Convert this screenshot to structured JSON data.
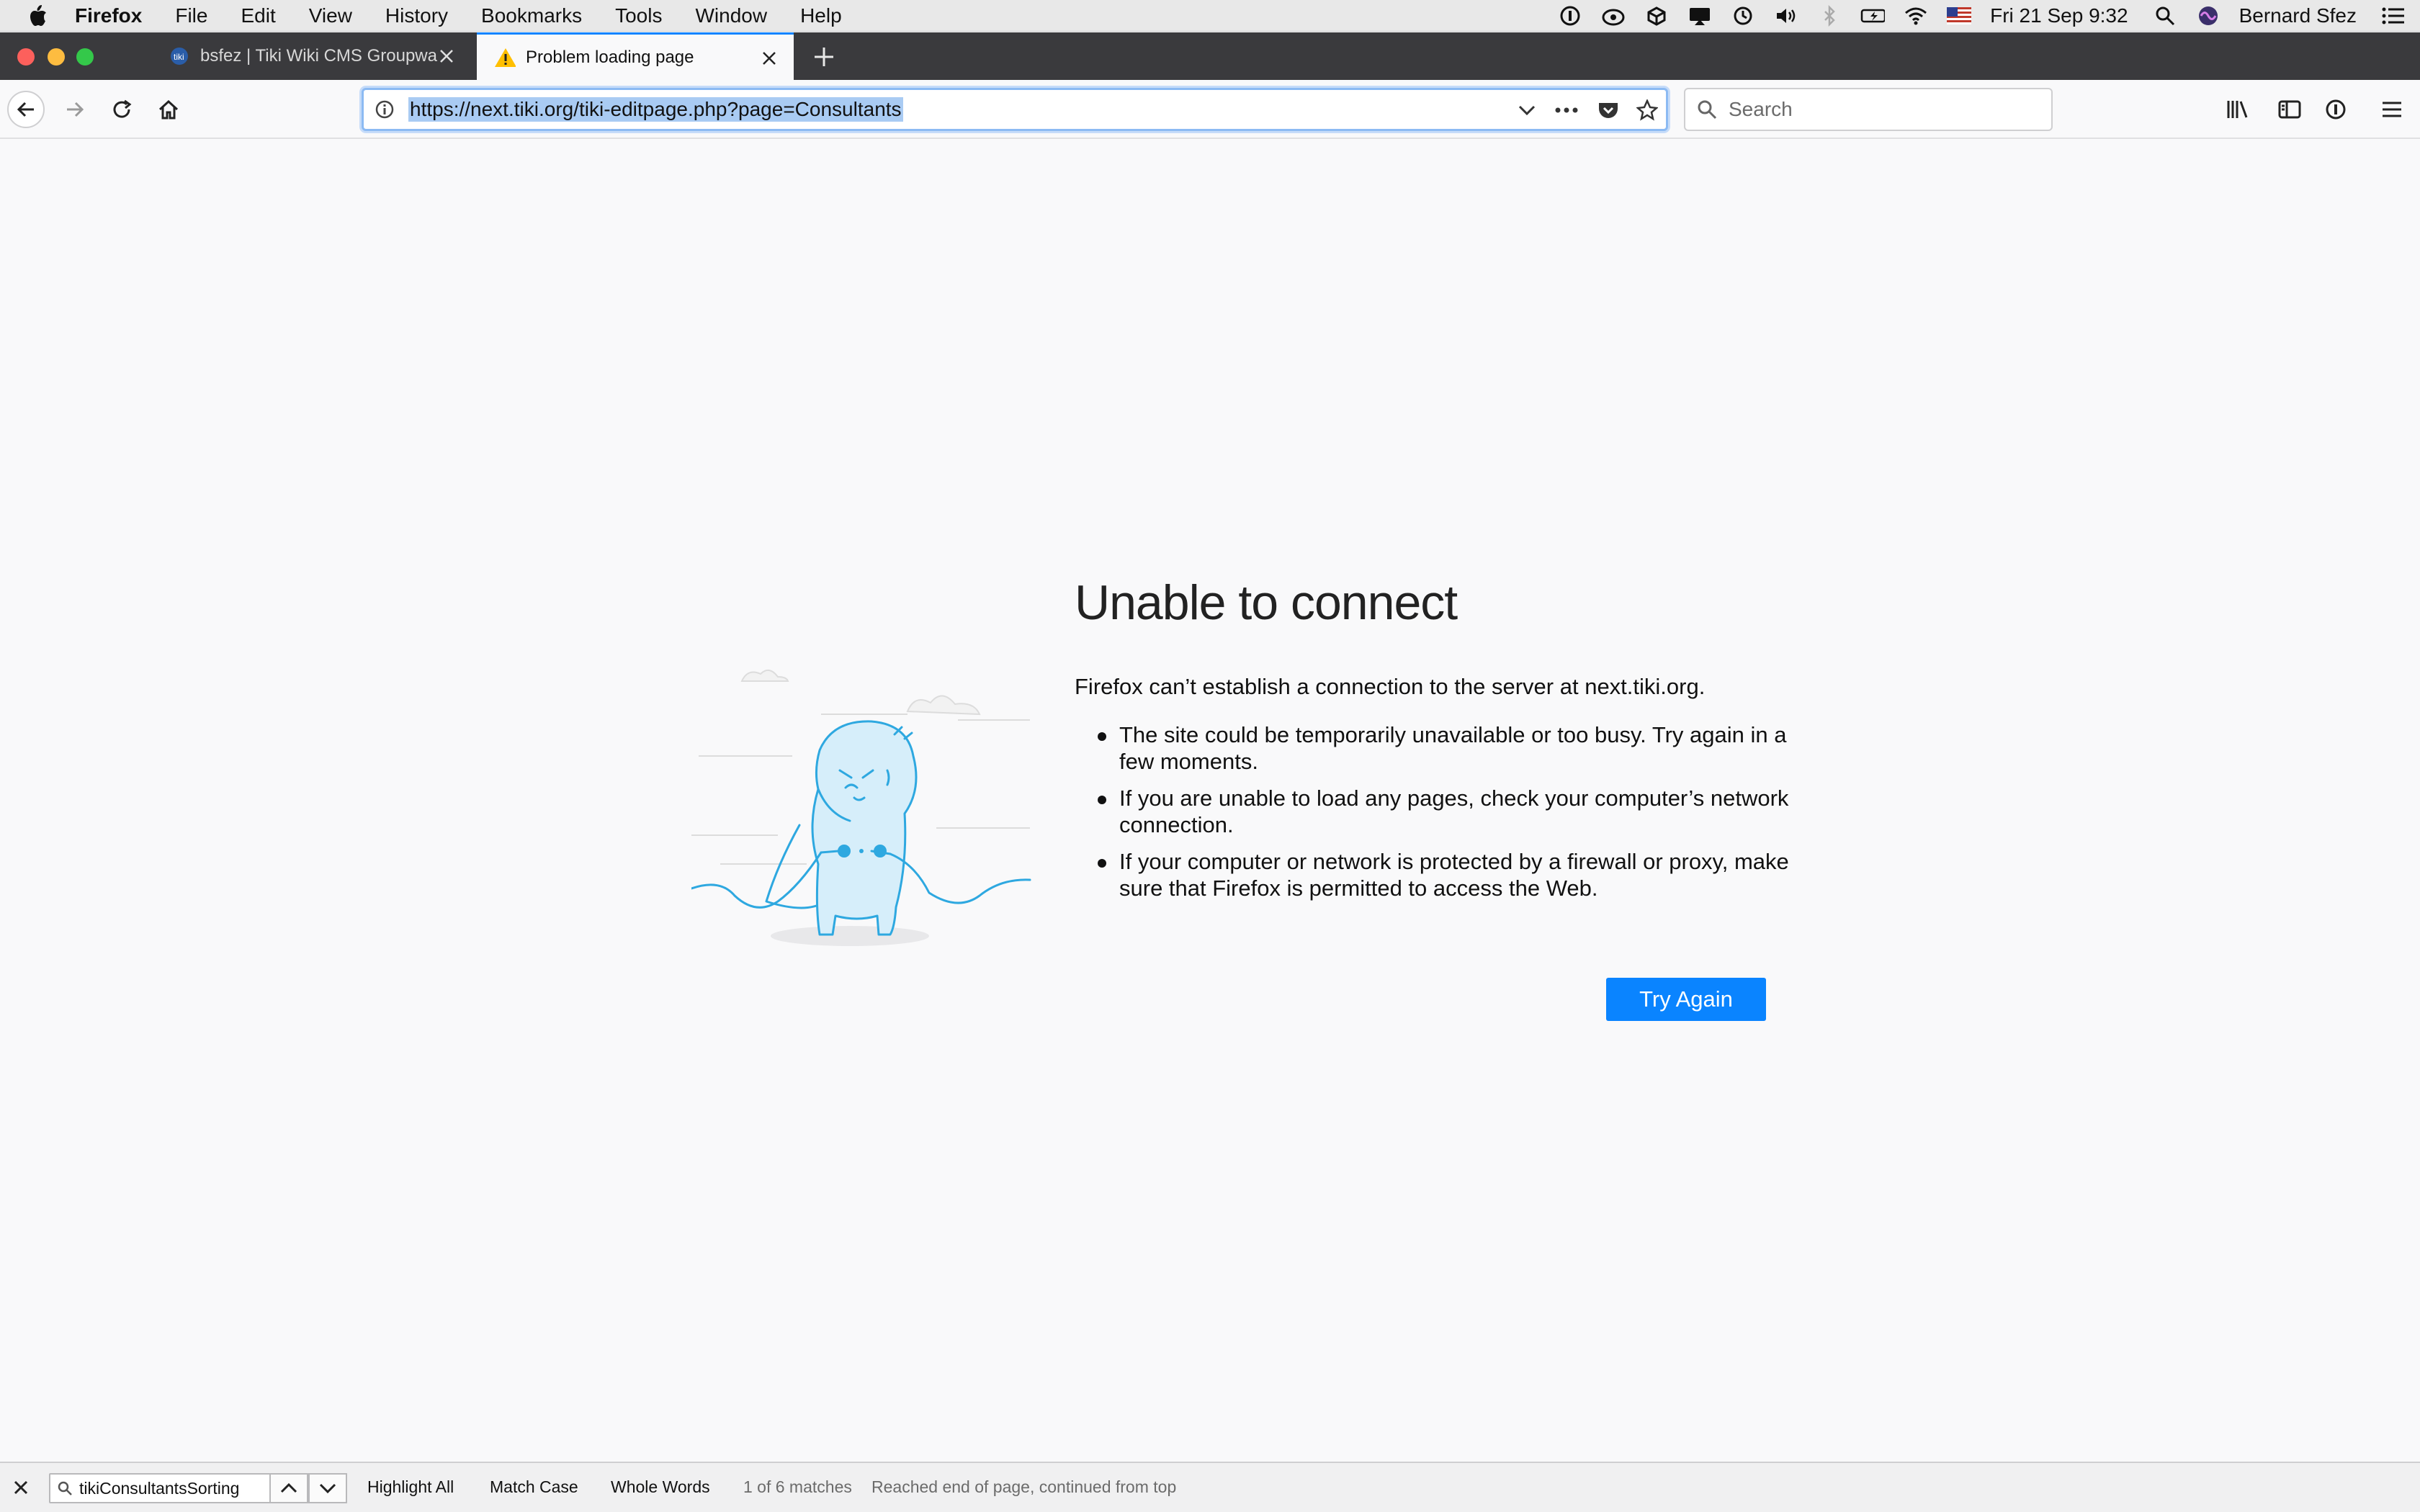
{
  "menubar": {
    "app_name": "Firefox",
    "items": [
      "File",
      "Edit",
      "View",
      "History",
      "Bookmarks",
      "Tools",
      "Window",
      "Help"
    ],
    "clock": "Fri 21 Sep  9:32",
    "user": "Bernard Sfez",
    "status_icons": [
      "onepassword-icon",
      "creative-cloud-icon",
      "dropbox-icon",
      "airplay-display-icon",
      "time-machine-icon",
      "volume-icon",
      "bluetooth-icon",
      "battery-charging-icon",
      "wifi-icon",
      "us-flag-icon"
    ]
  },
  "tabs": [
    {
      "title": "bsfez | Tiki Wiki CMS Groupware",
      "favicon": "tiki-icon",
      "active": false
    },
    {
      "title": "Problem loading page",
      "favicon": "warning-icon",
      "active": true
    }
  ],
  "toolbar": {
    "url": "https://next.tiki.org/tiki-editpage.php?page=Consultants",
    "search_placeholder": "Search"
  },
  "error": {
    "title": "Unable to connect",
    "description": "Firefox can’t establish a connection to the server at next.tiki.org.",
    "bullets": [
      "The site could be temporarily unavailable or too busy. Try again in a few moments.",
      "If you are unable to load any pages, check your computer’s network connection.",
      "If your computer or network is protected by a firewall or proxy, make sure that Firefox is permitted to access the Web."
    ],
    "button": "Try Again"
  },
  "findbar": {
    "query": "tikiConsultantsSorting",
    "highlight_all": "Highlight All",
    "match_case": "Match Case",
    "whole_words": "Whole Words",
    "matches": "1 of 6 matches",
    "status": "Reached end of page, continued from top"
  },
  "colors": {
    "accent": "#0a84ff",
    "tabstrip": "#3a3a3d",
    "illustration": "#2ea8e0"
  }
}
